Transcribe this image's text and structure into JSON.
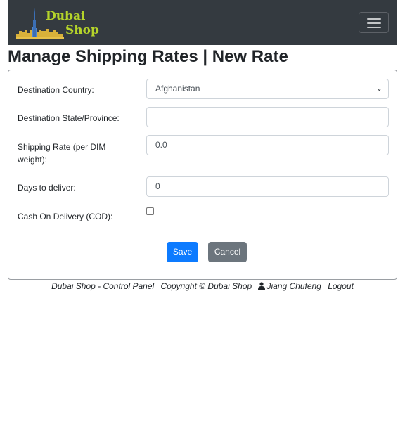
{
  "navbar": {
    "brand_line1": "Dubai",
    "brand_line2": "Shop",
    "toggler_icon": "hamburger-menu-icon"
  },
  "page": {
    "title": "Manage Shipping Rates | New Rate"
  },
  "form": {
    "destination_country": {
      "label": "Destination Country:",
      "value": "Afghanistan"
    },
    "destination_state": {
      "label": "Destination State/Province:",
      "value": ""
    },
    "shipping_rate": {
      "label_line1": "Shipping Rate (per DIM",
      "label_line2": "weight):",
      "value": "0.0"
    },
    "days_to_deliver": {
      "label": "Days to deliver:",
      "value": "0"
    },
    "cod": {
      "label": "Cash On Delivery (COD):",
      "checked": false
    },
    "save_label": "Save",
    "cancel_label": "Cancel"
  },
  "footer": {
    "panel": "Dubai Shop - Control Panel",
    "copyright": "Copyright © Dubai Shop",
    "user_icon": "user-icon",
    "user": "Jiang Chufeng",
    "logout": "Logout"
  },
  "colors": {
    "navbar_bg": "#343a40",
    "brand_text": "#b5d42a",
    "primary": "#0d7bff",
    "secondary": "#6c757d"
  }
}
